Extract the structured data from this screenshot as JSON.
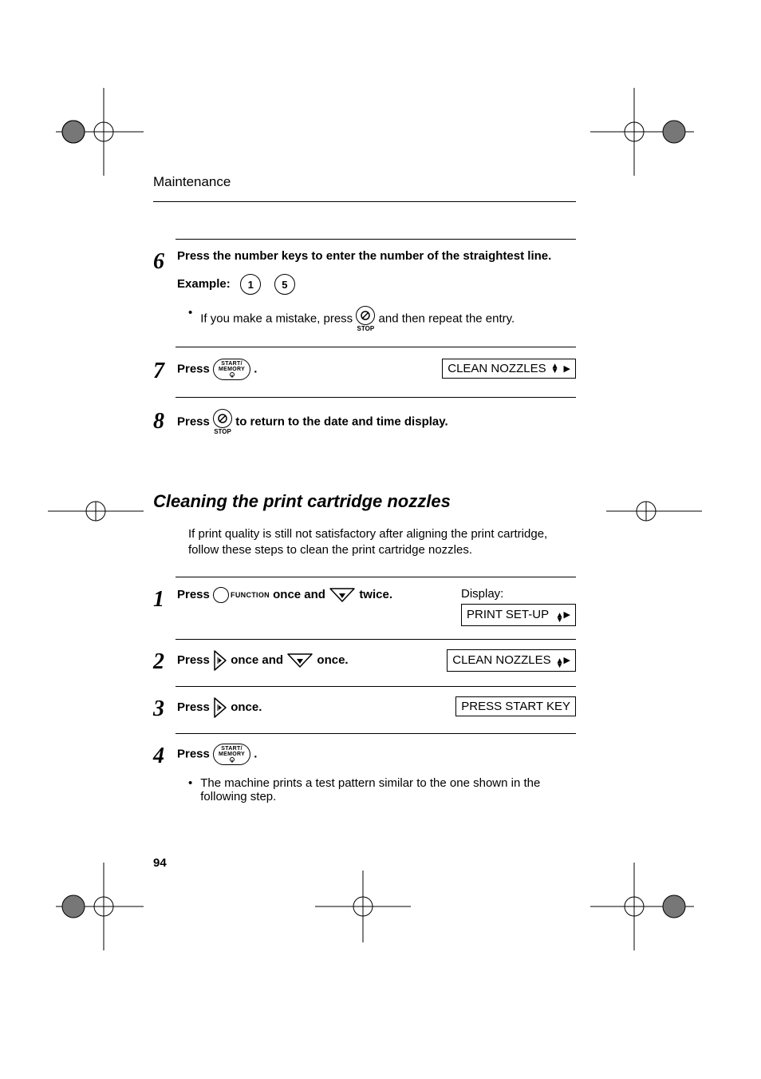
{
  "header": {
    "running_head": "Maintenance"
  },
  "page_number": "94",
  "section_title": "Cleaning the print cartridge nozzles",
  "section_intro": "If print quality is still not satisfactory after aligning the print cartridge, follow these steps to clean the print cartridge nozzles.",
  "steps_a": {
    "s6": {
      "num": "6",
      "text": "Press the number keys to enter the number of the straightest line.",
      "example_label": "Example:",
      "key1": "1",
      "key2": "5",
      "bullet_pre": "If you make a mistake, press ",
      "bullet_post": " and then repeat the entry."
    },
    "s7": {
      "num": "7",
      "press": "Press ",
      "period": " .",
      "display": "CLEAN NOZZLES"
    },
    "s8": {
      "num": "8",
      "press": "Press ",
      "post": " to return to the date and time display."
    }
  },
  "steps_b": {
    "s1": {
      "num": "1",
      "press": "Press ",
      "mid": " once and ",
      "post": " twice.",
      "display_label": "Display:",
      "display": "PRINT SET-UP"
    },
    "s2": {
      "num": "2",
      "press": "Press ",
      "mid": " once and ",
      "post": " once.",
      "display": "CLEAN NOZZLES"
    },
    "s3": {
      "num": "3",
      "press": "Press ",
      "post": " once.",
      "display": "PRESS START KEY"
    },
    "s4": {
      "num": "4",
      "press": "Press ",
      "period": " .",
      "bullet": "The machine prints a test pattern similar to the one shown in the following step."
    }
  },
  "keys": {
    "start_memory_l1": "START/",
    "start_memory_l2": "MEMORY",
    "stop": "STOP",
    "function": "FUNCTION"
  }
}
